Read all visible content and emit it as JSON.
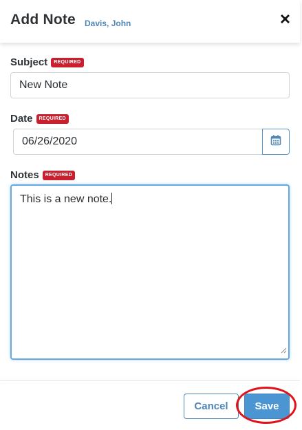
{
  "header": {
    "title": "Add Note",
    "subtitle": "Davis, John",
    "close_icon": "close-icon"
  },
  "required_badge": "REQUIRED",
  "fields": {
    "subject": {
      "label": "Subject",
      "value": "New Note"
    },
    "date": {
      "label": "Date",
      "value": "06/26/2020",
      "icon": "calendar-icon"
    },
    "notes": {
      "label": "Notes",
      "value": "This is a new note."
    }
  },
  "footer": {
    "cancel_label": "Cancel",
    "save_label": "Save"
  },
  "colors": {
    "accent": "#4b95d3",
    "badge": "#c8202e",
    "highlight": "#e0121a"
  }
}
